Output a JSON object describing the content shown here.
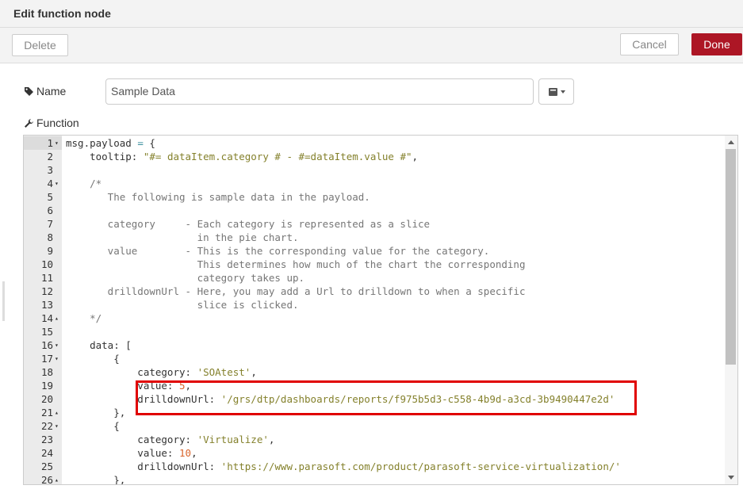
{
  "dialog": {
    "title": "Edit function node"
  },
  "toolbar": {
    "delete_label": "Delete",
    "cancel_label": "Cancel",
    "done_label": "Done"
  },
  "form": {
    "name_label": "Name",
    "name_value": "Sample Data",
    "function_label": "Function"
  },
  "colors": {
    "done": "#ad1625",
    "highlight": "#e00000"
  },
  "editor": {
    "lines": [
      {
        "n": "1",
        "fold": "▾",
        "text": "msg.payload = {"
      },
      {
        "n": "2",
        "fold": "",
        "text": "    tooltip: \"#= dataItem.category # - #=dataItem.value #\","
      },
      {
        "n": "3",
        "fold": "",
        "text": ""
      },
      {
        "n": "4",
        "fold": "▾",
        "text": "    /*"
      },
      {
        "n": "5",
        "fold": "",
        "text": "       The following is sample data in the payload."
      },
      {
        "n": "6",
        "fold": "",
        "text": ""
      },
      {
        "n": "7",
        "fold": "",
        "text": "       category     - Each category is represented as a slice"
      },
      {
        "n": "8",
        "fold": "",
        "text": "                      in the pie chart."
      },
      {
        "n": "9",
        "fold": "",
        "text": "       value        - This is the corresponding value for the category."
      },
      {
        "n": "10",
        "fold": "",
        "text": "                      This determines how much of the chart the corresponding"
      },
      {
        "n": "11",
        "fold": "",
        "text": "                      category takes up."
      },
      {
        "n": "12",
        "fold": "",
        "text": "       drilldownUrl - Here, you may add a Url to drilldown to when a specific"
      },
      {
        "n": "13",
        "fold": "",
        "text": "                      slice is clicked."
      },
      {
        "n": "14",
        "fold": "▴",
        "text": "    */"
      },
      {
        "n": "15",
        "fold": "",
        "text": ""
      },
      {
        "n": "16",
        "fold": "▾",
        "text": "    data: ["
      },
      {
        "n": "17",
        "fold": "▾",
        "text": "        {"
      },
      {
        "n": "18",
        "fold": "",
        "text": "            category: 'SOAtest',"
      },
      {
        "n": "19",
        "fold": "",
        "text": "            value: 5,"
      },
      {
        "n": "20",
        "fold": "",
        "text": "            drilldownUrl: '/grs/dtp/dashboards/reports/f975b5d3-c558-4b9d-a3cd-3b9490447e2d'"
      },
      {
        "n": "21",
        "fold": "▴",
        "text": "        },"
      },
      {
        "n": "22",
        "fold": "▾",
        "text": "        {"
      },
      {
        "n": "23",
        "fold": "",
        "text": "            category: 'Virtualize',"
      },
      {
        "n": "24",
        "fold": "",
        "text": "            value: 10,"
      },
      {
        "n": "25",
        "fold": "",
        "text": "            drilldownUrl: 'https://www.parasoft.com/product/parasoft-service-virtualization/'"
      },
      {
        "n": "26",
        "fold": "▴",
        "text": "        },"
      }
    ]
  }
}
